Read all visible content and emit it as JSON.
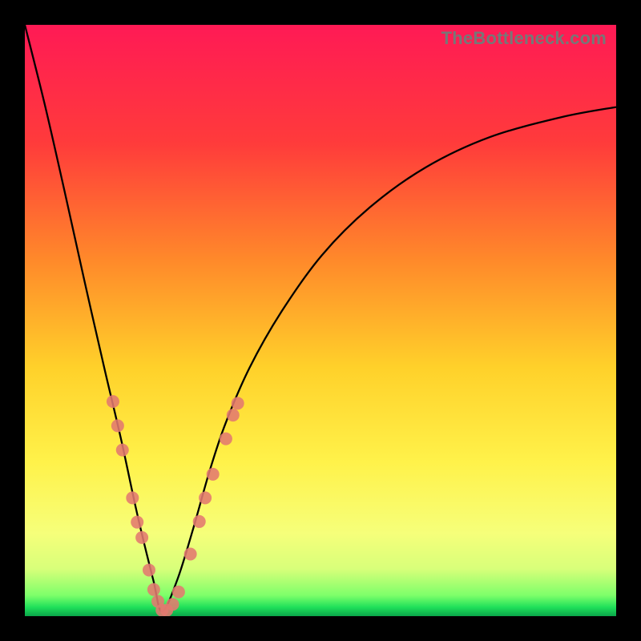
{
  "watermark": "TheBottleneck.com",
  "chart_data": {
    "type": "line",
    "title": "",
    "xlabel": "",
    "ylabel": "",
    "xlim": [
      0,
      1
    ],
    "ylim": [
      0,
      1
    ],
    "note": "Axes are unlabeled; values are normalized 0–1 estimated from pixels. Curve is a V-shaped bottleneck profile with minimum near x≈0.232.",
    "gradient_stops": [
      {
        "pos": 0.0,
        "color": "#ff1a55"
      },
      {
        "pos": 0.2,
        "color": "#ff3b3b"
      },
      {
        "pos": 0.4,
        "color": "#ff8a2a"
      },
      {
        "pos": 0.58,
        "color": "#ffd12a"
      },
      {
        "pos": 0.74,
        "color": "#fff24a"
      },
      {
        "pos": 0.86,
        "color": "#f6ff7a"
      },
      {
        "pos": 0.92,
        "color": "#d8ff7a"
      },
      {
        "pos": 0.965,
        "color": "#7dff6a"
      },
      {
        "pos": 0.985,
        "color": "#1fe05a"
      },
      {
        "pos": 1.0,
        "color": "#0aa64a"
      }
    ],
    "series": [
      {
        "name": "bottleneck-curve",
        "x": [
          0.0,
          0.034,
          0.068,
          0.101,
          0.135,
          0.163,
          0.19,
          0.217,
          0.232,
          0.258,
          0.285,
          0.312,
          0.339,
          0.38,
          0.434,
          0.502,
          0.583,
          0.678,
          0.786,
          0.908,
          1.0
        ],
        "y": [
          1.0,
          0.864,
          0.715,
          0.566,
          0.417,
          0.298,
          0.173,
          0.062,
          0.008,
          0.062,
          0.149,
          0.244,
          0.325,
          0.42,
          0.515,
          0.61,
          0.691,
          0.759,
          0.81,
          0.844,
          0.861
        ]
      }
    ],
    "markers": {
      "name": "highlight-dots",
      "color": "#e2796f",
      "radius_px": 8,
      "points_xy": [
        [
          0.149,
          0.363
        ],
        [
          0.157,
          0.322
        ],
        [
          0.165,
          0.281
        ],
        [
          0.182,
          0.2
        ],
        [
          0.19,
          0.159
        ],
        [
          0.198,
          0.133
        ],
        [
          0.21,
          0.078
        ],
        [
          0.218,
          0.045
        ],
        [
          0.225,
          0.025
        ],
        [
          0.232,
          0.01
        ],
        [
          0.24,
          0.01
        ],
        [
          0.25,
          0.02
        ],
        [
          0.26,
          0.041
        ],
        [
          0.28,
          0.105
        ],
        [
          0.295,
          0.16
        ],
        [
          0.305,
          0.2
        ],
        [
          0.318,
          0.24
        ],
        [
          0.34,
          0.3
        ],
        [
          0.352,
          0.34
        ],
        [
          0.36,
          0.36
        ]
      ]
    }
  }
}
